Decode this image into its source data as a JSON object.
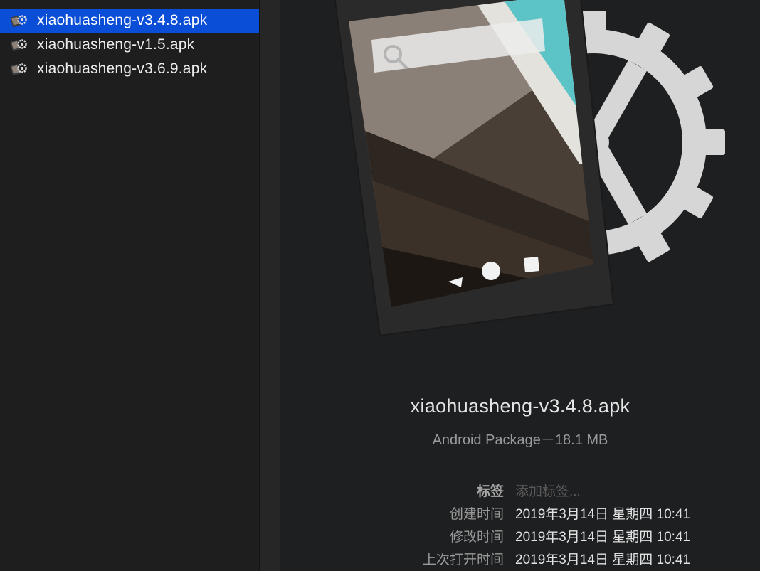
{
  "files": [
    {
      "name": "xiaohuasheng-v3.4.8.apk",
      "selected": true,
      "icon": "apk-file-icon"
    },
    {
      "name": "xiaohuasheng-v1.5.apk",
      "selected": false,
      "icon": "apk-file-icon"
    },
    {
      "name": "xiaohuasheng-v3.6.9.apk",
      "selected": false,
      "icon": "apk-file-icon"
    }
  ],
  "preview": {
    "icon": "android-package-preview-icon",
    "title": "xiaohuasheng-v3.4.8.apk",
    "subtitle": "Android Package－18.1 MB",
    "tags_label": "标签",
    "tags_placeholder": "添加标签...",
    "created_label": "创建时间",
    "created_value": "2019年3月14日 星期四 10:41",
    "modified_label": "修改时间",
    "modified_value": "2019年3月14日 星期四 10:41",
    "last_opened_label": "上次打开时间",
    "last_opened_value": "2019年3月14日 星期四 10:41"
  },
  "colors": {
    "selection": "#0a4ed8",
    "background": "#1e1f20",
    "phone_body": "#2b2b2c",
    "screen_teal": "#5cc3c6",
    "gear": "#d8d8d8"
  }
}
